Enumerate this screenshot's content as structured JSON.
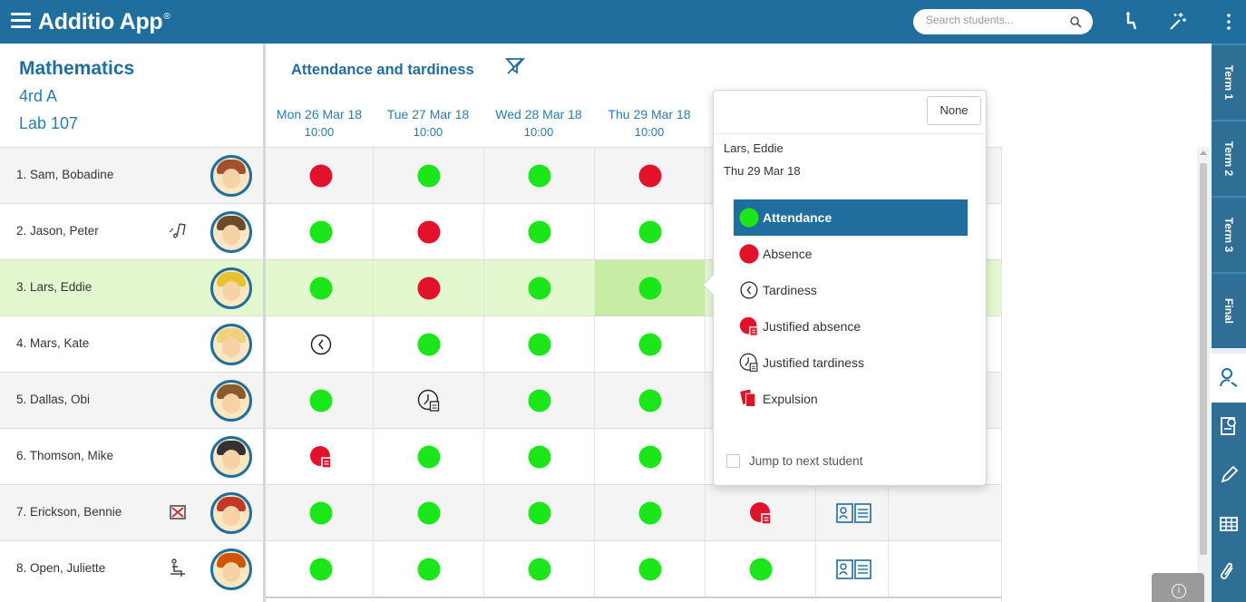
{
  "app": {
    "title": "Additio App",
    "trademark": "®",
    "search_placeholder": "Search students..."
  },
  "class_info": {
    "subject": "Mathematics",
    "group": "4rd A",
    "room": "Lab 107"
  },
  "grid": {
    "title": "Attendance and tardiness",
    "columns": [
      {
        "date": "Mon 26 Mar 18",
        "time": "10:00"
      },
      {
        "date": "Tue 27 Mar 18",
        "time": "10:00"
      },
      {
        "date": "Wed 28 Mar 18",
        "time": "10:00"
      },
      {
        "date": "Thu 29 Mar 18",
        "time": "10:00"
      }
    ]
  },
  "students": [
    {
      "name": "1. Sam, Bobadine",
      "marks": [
        "absence",
        "attendance",
        "attendance",
        "absence"
      ],
      "tag": "",
      "hair": "#a0522d"
    },
    {
      "name": "2. Jason, Peter",
      "marks": [
        "attendance",
        "absence",
        "attendance",
        "attendance"
      ],
      "tag": "note-icon",
      "hair": "#6b4b2a"
    },
    {
      "name": "3. Lars, Eddie",
      "marks": [
        "attendance",
        "absence",
        "attendance",
        "attendance"
      ],
      "tag": "",
      "hair": "#e8c22f"
    },
    {
      "name": "4. Mars, Kate",
      "marks": [
        "tardiness",
        "attendance",
        "attendance",
        "attendance"
      ],
      "tag": "",
      "hair": "#f0d27a"
    },
    {
      "name": "5. Dallas, Obi",
      "marks": [
        "attendance",
        "justified-tardiness",
        "attendance",
        "attendance"
      ],
      "tag": "",
      "hair": "#8b5a2b"
    },
    {
      "name": "6. Thomson, Mike",
      "marks": [
        "justified-absence",
        "attendance",
        "attendance",
        "attendance"
      ],
      "tag": "",
      "hair": "#333333"
    },
    {
      "name": "7. Erickson, Bennie",
      "marks": [
        "attendance",
        "attendance",
        "attendance",
        "attendance"
      ],
      "extra": "justified-absence",
      "tag": "no-device-icon",
      "hair": "#c0392b"
    },
    {
      "name": "8. Open, Juliette",
      "marks": [
        "attendance",
        "attendance",
        "attendance",
        "attendance"
      ],
      "extra": "attendance",
      "tag": "seat-icon",
      "hair": "#d35400"
    }
  ],
  "popover": {
    "none_label": "None",
    "student": "Lars, Eddie",
    "date": "Thu 29 Mar 18",
    "options": [
      {
        "label": "Attendance",
        "type": "attendance",
        "selected": true
      },
      {
        "label": "Absence",
        "type": "absence",
        "selected": false
      },
      {
        "label": "Tardiness",
        "type": "tardiness",
        "selected": false
      },
      {
        "label": "Justified absence",
        "type": "justified-absence",
        "selected": false
      },
      {
        "label": "Justified tardiness",
        "type": "justified-tardiness",
        "selected": false
      },
      {
        "label": "Expulsion",
        "type": "expulsion",
        "selected": false
      }
    ],
    "jump_label": "Jump to next student"
  },
  "terms": [
    "Term 1",
    "Term 2",
    "Term 3",
    "Final"
  ],
  "side_tools": [
    "user-icon",
    "report-icon",
    "pencil-icon",
    "table-icon",
    "attach-icon"
  ],
  "colors": {
    "brand": "#1f6e9d",
    "attendance": "#1ae61a",
    "absence": "#e3122b",
    "selected_row": "#e3f8cf"
  }
}
